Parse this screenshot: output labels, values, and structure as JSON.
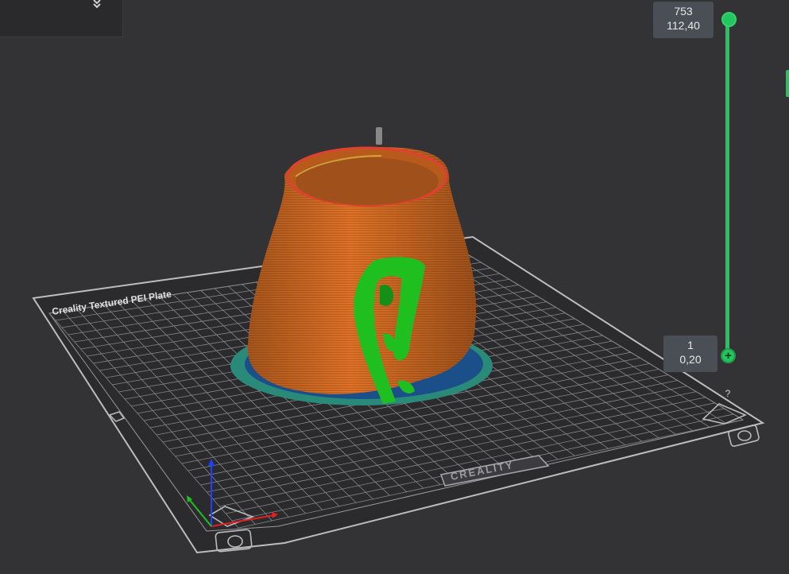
{
  "plate": {
    "title": "Creality Textured PEI Plate",
    "brand": "CREALITY"
  },
  "layer_slider": {
    "top": {
      "layer": "753",
      "height": "112,40"
    },
    "bottom": {
      "layer": "1",
      "height": "0,20"
    }
  },
  "help": {
    "label": "?"
  },
  "icons": {
    "collapse": "double-chevron-down-icon",
    "help": "help-icon",
    "add": "plus-icon"
  },
  "colors": {
    "background": "#333336",
    "plate": "#2b2b2e",
    "grid": "#8a8a8e",
    "model_wall": "#d2691e",
    "support": "#1fbf1f",
    "brim_outer": "#2a8a7a",
    "brim_inner": "#1a4f8a",
    "slider": "#22c55e",
    "axis_x": "#e02020",
    "axis_y": "#20c020",
    "axis_z": "#2040ff"
  }
}
